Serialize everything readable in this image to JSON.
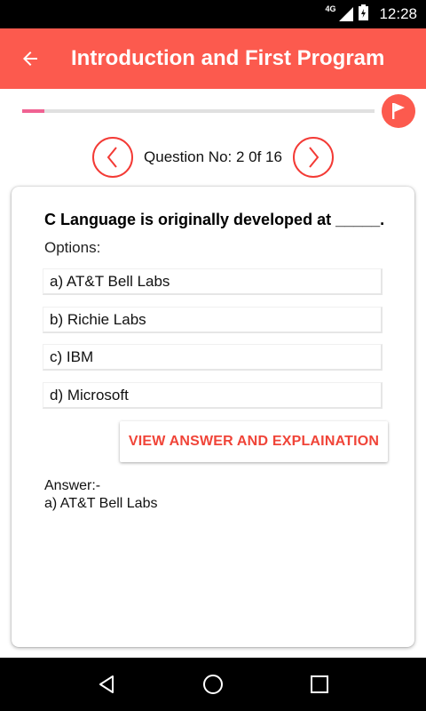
{
  "status_bar": {
    "network": "4G",
    "time": "12:28"
  },
  "app_bar": {
    "title": "Introduction and First Program",
    "back_icon": "arrow-left-icon",
    "color": "#fc5a4e"
  },
  "progress": {
    "current": 2,
    "total": 16,
    "fill_color": "#f06292",
    "flag_icon": "flag-icon"
  },
  "question_nav": {
    "label": "Question No: 2 0f 16",
    "prev_icon": "chevron-left-icon",
    "next_icon": "chevron-right-icon",
    "accent": "#f33a35"
  },
  "question": {
    "text": "C Language is originally developed at _____.",
    "options_label": "Options:",
    "options": [
      "a) AT&T Bell Labs",
      "b) Richie Labs",
      "c) IBM",
      "d) Microsoft"
    ],
    "view_button": "VIEW ANSWER AND EXPLAINATION",
    "answer_title": "Answer:-",
    "answer": "a) AT&T Bell Labs"
  },
  "nav_bar": {
    "back": "triangle-back-icon",
    "home": "circle-home-icon",
    "recents": "square-recents-icon"
  }
}
